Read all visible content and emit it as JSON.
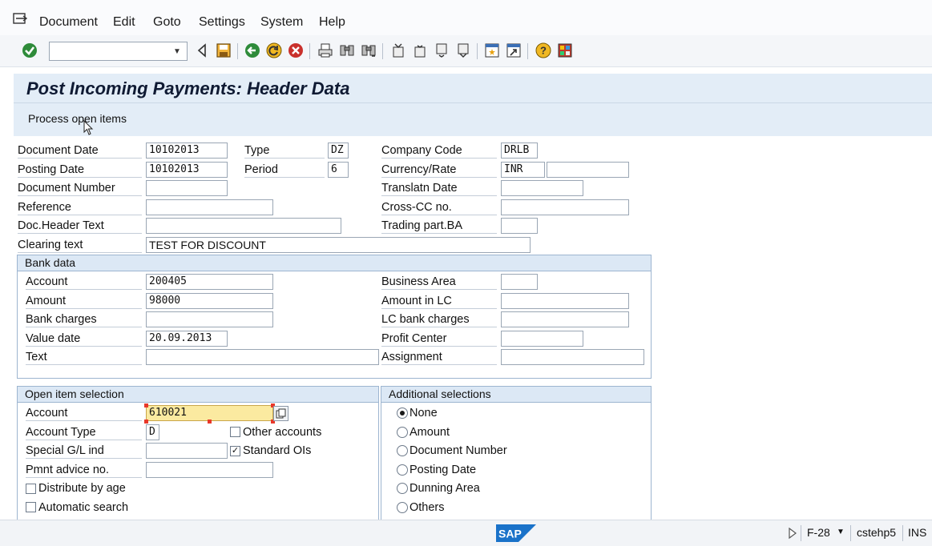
{
  "menu": {
    "items": [
      "Document",
      "Edit",
      "Goto",
      "Settings",
      "System",
      "Help"
    ]
  },
  "toolbar": {
    "command_value": ""
  },
  "title": "Post Incoming Payments: Header Data",
  "app_toolbar": {
    "process_label": "Process open items"
  },
  "header": {
    "document_date": {
      "label": "Document Date",
      "value": "10102013"
    },
    "posting_date": {
      "label": "Posting Date",
      "value": "10102013"
    },
    "document_number": {
      "label": "Document Number",
      "value": ""
    },
    "reference": {
      "label": "Reference",
      "value": ""
    },
    "doc_header_text": {
      "label": "Doc.Header Text",
      "value": ""
    },
    "clearing_text": {
      "label": "Clearing text",
      "value": "TEST FOR DISCOUNT"
    },
    "type": {
      "label": "Type",
      "value": "DZ"
    },
    "period": {
      "label": "Period",
      "value": "6"
    },
    "company_code": {
      "label": "Company Code",
      "value": "DRLB"
    },
    "currency_rate": {
      "label": "Currency/Rate",
      "currency": "INR",
      "rate": ""
    },
    "translatn_date": {
      "label": "Translatn Date",
      "value": ""
    },
    "cross_cc": {
      "label": "Cross-CC no.",
      "value": ""
    },
    "trading_part": {
      "label": "Trading part.BA",
      "value": ""
    }
  },
  "bank_data": {
    "title": "Bank data",
    "account": {
      "label": "Account",
      "value": "200405"
    },
    "amount": {
      "label": "Amount",
      "value": "98000"
    },
    "bank_charges": {
      "label": "Bank charges",
      "value": ""
    },
    "value_date": {
      "label": "Value date",
      "value": "20.09.2013"
    },
    "text": {
      "label": "Text",
      "value": ""
    },
    "business_area": {
      "label": "Business Area",
      "value": ""
    },
    "amount_lc": {
      "label": "Amount in LC",
      "value": ""
    },
    "lc_bank_charges": {
      "label": "LC bank charges",
      "value": ""
    },
    "profit_center": {
      "label": "Profit Center",
      "value": ""
    },
    "assignment": {
      "label": "Assignment",
      "value": ""
    }
  },
  "open_items": {
    "title": "Open item selection",
    "account": {
      "label": "Account",
      "value": "610021"
    },
    "account_type": {
      "label": "Account Type",
      "value": "D"
    },
    "special_gl": {
      "label": "Special G/L ind",
      "value": ""
    },
    "pmnt_advice": {
      "label": "Pmnt advice no.",
      "value": ""
    },
    "other_accounts": {
      "label": "Other accounts",
      "checked": false
    },
    "standard_ois": {
      "label": "Standard OIs",
      "checked": true
    },
    "distribute_by_age": {
      "label": "Distribute by age",
      "checked": false
    },
    "automatic_search": {
      "label": "Automatic search",
      "checked": false
    }
  },
  "additional_selections": {
    "title": "Additional selections",
    "options": [
      "None",
      "Amount",
      "Document Number",
      "Posting Date",
      "Dunning Area",
      "Others"
    ],
    "selected": "None"
  },
  "status_bar": {
    "logo": "SAP",
    "transaction": "F-28",
    "server": "cstehp5",
    "mode": "INS"
  },
  "colors": {
    "title_bg": "#e3edf7",
    "group_header_bg": "#dce8f5",
    "required_field_bg": "#fbeaa0",
    "sap_logo": "#1a72c9"
  }
}
